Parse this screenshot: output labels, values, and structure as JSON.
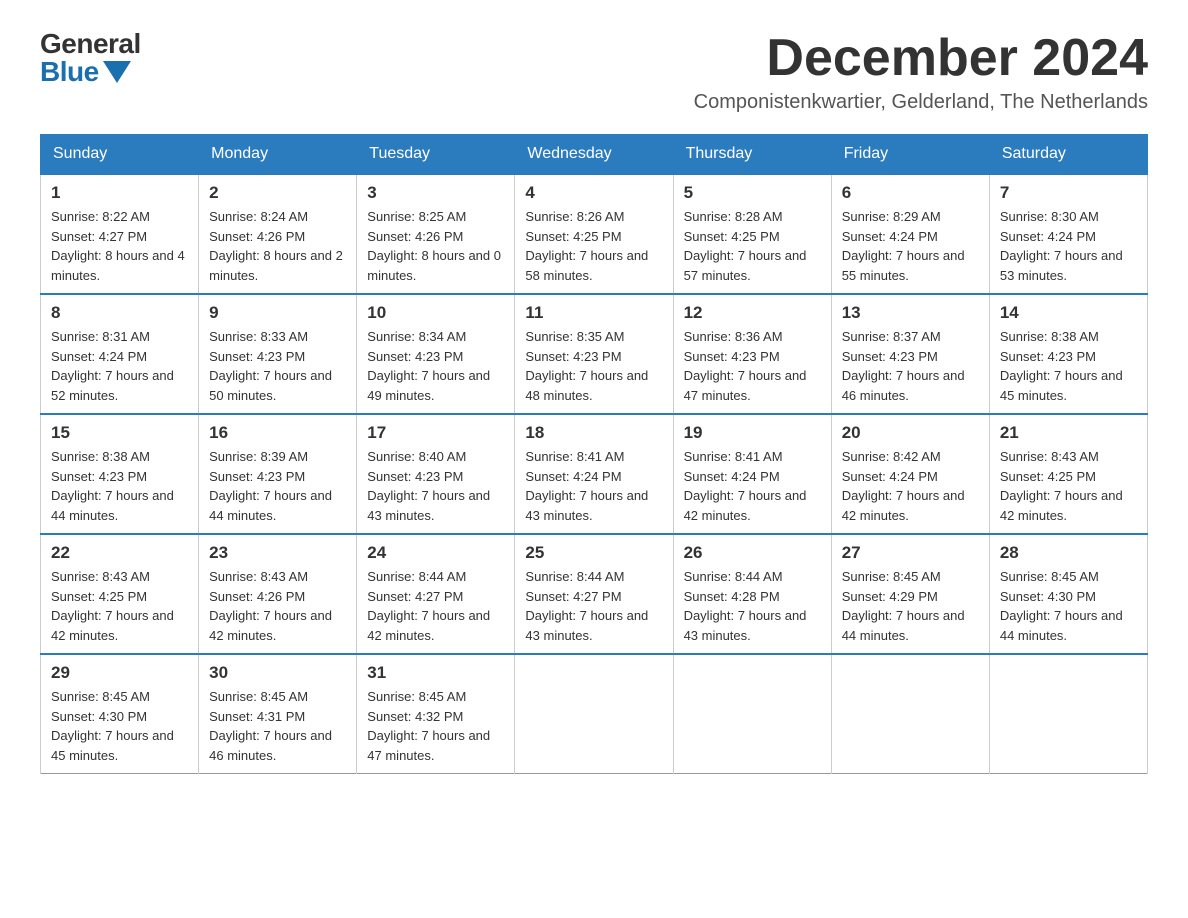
{
  "logo": {
    "general": "General",
    "blue": "Blue"
  },
  "header": {
    "month_year": "December 2024",
    "location": "Componistenkwartier, Gelderland, The Netherlands"
  },
  "weekdays": [
    "Sunday",
    "Monday",
    "Tuesday",
    "Wednesday",
    "Thursday",
    "Friday",
    "Saturday"
  ],
  "weeks": [
    [
      {
        "day": "1",
        "sunrise": "8:22 AM",
        "sunset": "4:27 PM",
        "daylight": "8 hours and 4 minutes."
      },
      {
        "day": "2",
        "sunrise": "8:24 AM",
        "sunset": "4:26 PM",
        "daylight": "8 hours and 2 minutes."
      },
      {
        "day": "3",
        "sunrise": "8:25 AM",
        "sunset": "4:26 PM",
        "daylight": "8 hours and 0 minutes."
      },
      {
        "day": "4",
        "sunrise": "8:26 AM",
        "sunset": "4:25 PM",
        "daylight": "7 hours and 58 minutes."
      },
      {
        "day": "5",
        "sunrise": "8:28 AM",
        "sunset": "4:25 PM",
        "daylight": "7 hours and 57 minutes."
      },
      {
        "day": "6",
        "sunrise": "8:29 AM",
        "sunset": "4:24 PM",
        "daylight": "7 hours and 55 minutes."
      },
      {
        "day": "7",
        "sunrise": "8:30 AM",
        "sunset": "4:24 PM",
        "daylight": "7 hours and 53 minutes."
      }
    ],
    [
      {
        "day": "8",
        "sunrise": "8:31 AM",
        "sunset": "4:24 PM",
        "daylight": "7 hours and 52 minutes."
      },
      {
        "day": "9",
        "sunrise": "8:33 AM",
        "sunset": "4:23 PM",
        "daylight": "7 hours and 50 minutes."
      },
      {
        "day": "10",
        "sunrise": "8:34 AM",
        "sunset": "4:23 PM",
        "daylight": "7 hours and 49 minutes."
      },
      {
        "day": "11",
        "sunrise": "8:35 AM",
        "sunset": "4:23 PM",
        "daylight": "7 hours and 48 minutes."
      },
      {
        "day": "12",
        "sunrise": "8:36 AM",
        "sunset": "4:23 PM",
        "daylight": "7 hours and 47 minutes."
      },
      {
        "day": "13",
        "sunrise": "8:37 AM",
        "sunset": "4:23 PM",
        "daylight": "7 hours and 46 minutes."
      },
      {
        "day": "14",
        "sunrise": "8:38 AM",
        "sunset": "4:23 PM",
        "daylight": "7 hours and 45 minutes."
      }
    ],
    [
      {
        "day": "15",
        "sunrise": "8:38 AM",
        "sunset": "4:23 PM",
        "daylight": "7 hours and 44 minutes."
      },
      {
        "day": "16",
        "sunrise": "8:39 AM",
        "sunset": "4:23 PM",
        "daylight": "7 hours and 44 minutes."
      },
      {
        "day": "17",
        "sunrise": "8:40 AM",
        "sunset": "4:23 PM",
        "daylight": "7 hours and 43 minutes."
      },
      {
        "day": "18",
        "sunrise": "8:41 AM",
        "sunset": "4:24 PM",
        "daylight": "7 hours and 43 minutes."
      },
      {
        "day": "19",
        "sunrise": "8:41 AM",
        "sunset": "4:24 PM",
        "daylight": "7 hours and 42 minutes."
      },
      {
        "day": "20",
        "sunrise": "8:42 AM",
        "sunset": "4:24 PM",
        "daylight": "7 hours and 42 minutes."
      },
      {
        "day": "21",
        "sunrise": "8:43 AM",
        "sunset": "4:25 PM",
        "daylight": "7 hours and 42 minutes."
      }
    ],
    [
      {
        "day": "22",
        "sunrise": "8:43 AM",
        "sunset": "4:25 PM",
        "daylight": "7 hours and 42 minutes."
      },
      {
        "day": "23",
        "sunrise": "8:43 AM",
        "sunset": "4:26 PM",
        "daylight": "7 hours and 42 minutes."
      },
      {
        "day": "24",
        "sunrise": "8:44 AM",
        "sunset": "4:27 PM",
        "daylight": "7 hours and 42 minutes."
      },
      {
        "day": "25",
        "sunrise": "8:44 AM",
        "sunset": "4:27 PM",
        "daylight": "7 hours and 43 minutes."
      },
      {
        "day": "26",
        "sunrise": "8:44 AM",
        "sunset": "4:28 PM",
        "daylight": "7 hours and 43 minutes."
      },
      {
        "day": "27",
        "sunrise": "8:45 AM",
        "sunset": "4:29 PM",
        "daylight": "7 hours and 44 minutes."
      },
      {
        "day": "28",
        "sunrise": "8:45 AM",
        "sunset": "4:30 PM",
        "daylight": "7 hours and 44 minutes."
      }
    ],
    [
      {
        "day": "29",
        "sunrise": "8:45 AM",
        "sunset": "4:30 PM",
        "daylight": "7 hours and 45 minutes."
      },
      {
        "day": "30",
        "sunrise": "8:45 AM",
        "sunset": "4:31 PM",
        "daylight": "7 hours and 46 minutes."
      },
      {
        "day": "31",
        "sunrise": "8:45 AM",
        "sunset": "4:32 PM",
        "daylight": "7 hours and 47 minutes."
      },
      null,
      null,
      null,
      null
    ]
  ]
}
